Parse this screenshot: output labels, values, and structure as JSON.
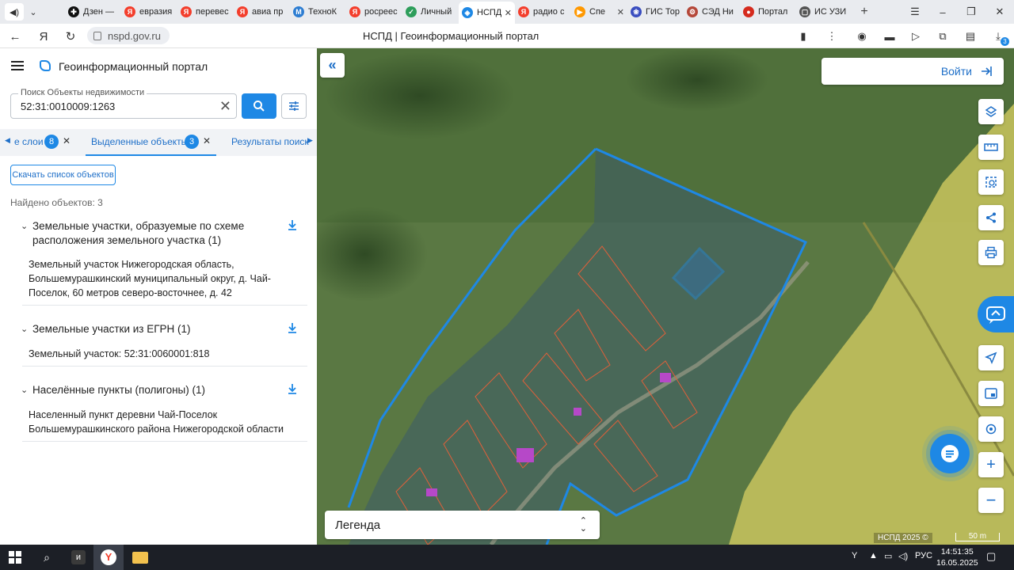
{
  "browser": {
    "tabs": [
      {
        "label": "Дзен —",
        "color": "#111111",
        "glyph": "✚"
      },
      {
        "label": "евразия",
        "color": "#f33e2c",
        "glyph": "Я"
      },
      {
        "label": "перевес",
        "color": "#f33e2c",
        "glyph": "Я"
      },
      {
        "label": "авиа пр",
        "color": "#f33e2c",
        "glyph": "Я"
      },
      {
        "label": "ТехноК",
        "color": "#2d7dd2",
        "glyph": "M"
      },
      {
        "label": "росреес",
        "color": "#f33e2c",
        "glyph": "Я"
      },
      {
        "label": "Личный",
        "color": "#2e9e5b",
        "glyph": "✓"
      },
      {
        "label": "НСПД",
        "color": "#1e88e5",
        "glyph": "◈"
      },
      {
        "label": "радио с",
        "color": "#f33e2c",
        "glyph": "Я"
      },
      {
        "label": "Спе",
        "color": "#ff9800",
        "glyph": "▶"
      },
      {
        "label": "ГИС Тор",
        "color": "#3a4ec0",
        "glyph": "❀"
      },
      {
        "label": "СЭД Ни",
        "color": "#b5483a",
        "glyph": "⚙"
      },
      {
        "label": "Портал",
        "color": "#d52b1e",
        "glyph": "●"
      },
      {
        "label": "ИС УЗИ",
        "color": "#555555",
        "glyph": "▢"
      }
    ],
    "url": "nspd.gov.ru",
    "page_title": "НСПД | Геоинформационный портал",
    "downloads_badge": "3"
  },
  "panel": {
    "brand": "Геоинформационный портал",
    "search": {
      "label": "Поиск Объекты недвижимости",
      "value": "52:31:0010009:1263"
    },
    "tabs": {
      "layers_label": "е слои",
      "layers_count": "8",
      "selected_label": "Выделенные объекты",
      "selected_count": "3",
      "results_label": "Результаты поиск"
    },
    "download_list_label": "Скачать список объектов",
    "found_text": "Найдено объектов: 3",
    "groups": [
      {
        "title": "Земельные участки, образуемые по схеме расположения земельного участка (1)",
        "item": "Земельный участок Нижегородская область, Большемурашкинский муниципальный округ, д. Чай-Поселок, 60 метров северо-восточнее, д. 42"
      },
      {
        "title": "Земельные участки из ЕГРН (1)",
        "item": "Земельный участок: 52:31:0060001:818"
      },
      {
        "title": "Населённые пункты (полигоны) (1)",
        "item": "Населенный пункт деревни Чай-Поселок Большемурашкинского района Нижегородской области"
      }
    ]
  },
  "map": {
    "login_label": "Войти",
    "legend_label": "Легенда",
    "copyright": "НСПД 2025 ©",
    "scale_label": "50 m",
    "tools": [
      "layers-icon",
      "ruler-icon",
      "select-area-icon",
      "share-icon",
      "print-icon",
      "navigate-icon",
      "minimap-icon",
      "geolocate-icon",
      "zoom-in-icon",
      "zoom-out-icon"
    ],
    "colors": {
      "boundary": "#1e88e5",
      "parcel": "#e0603a",
      "field": "#d9d46a"
    }
  },
  "taskbar": {
    "language": "РУС",
    "time": "14:51:35",
    "date": "16.05.2025"
  }
}
